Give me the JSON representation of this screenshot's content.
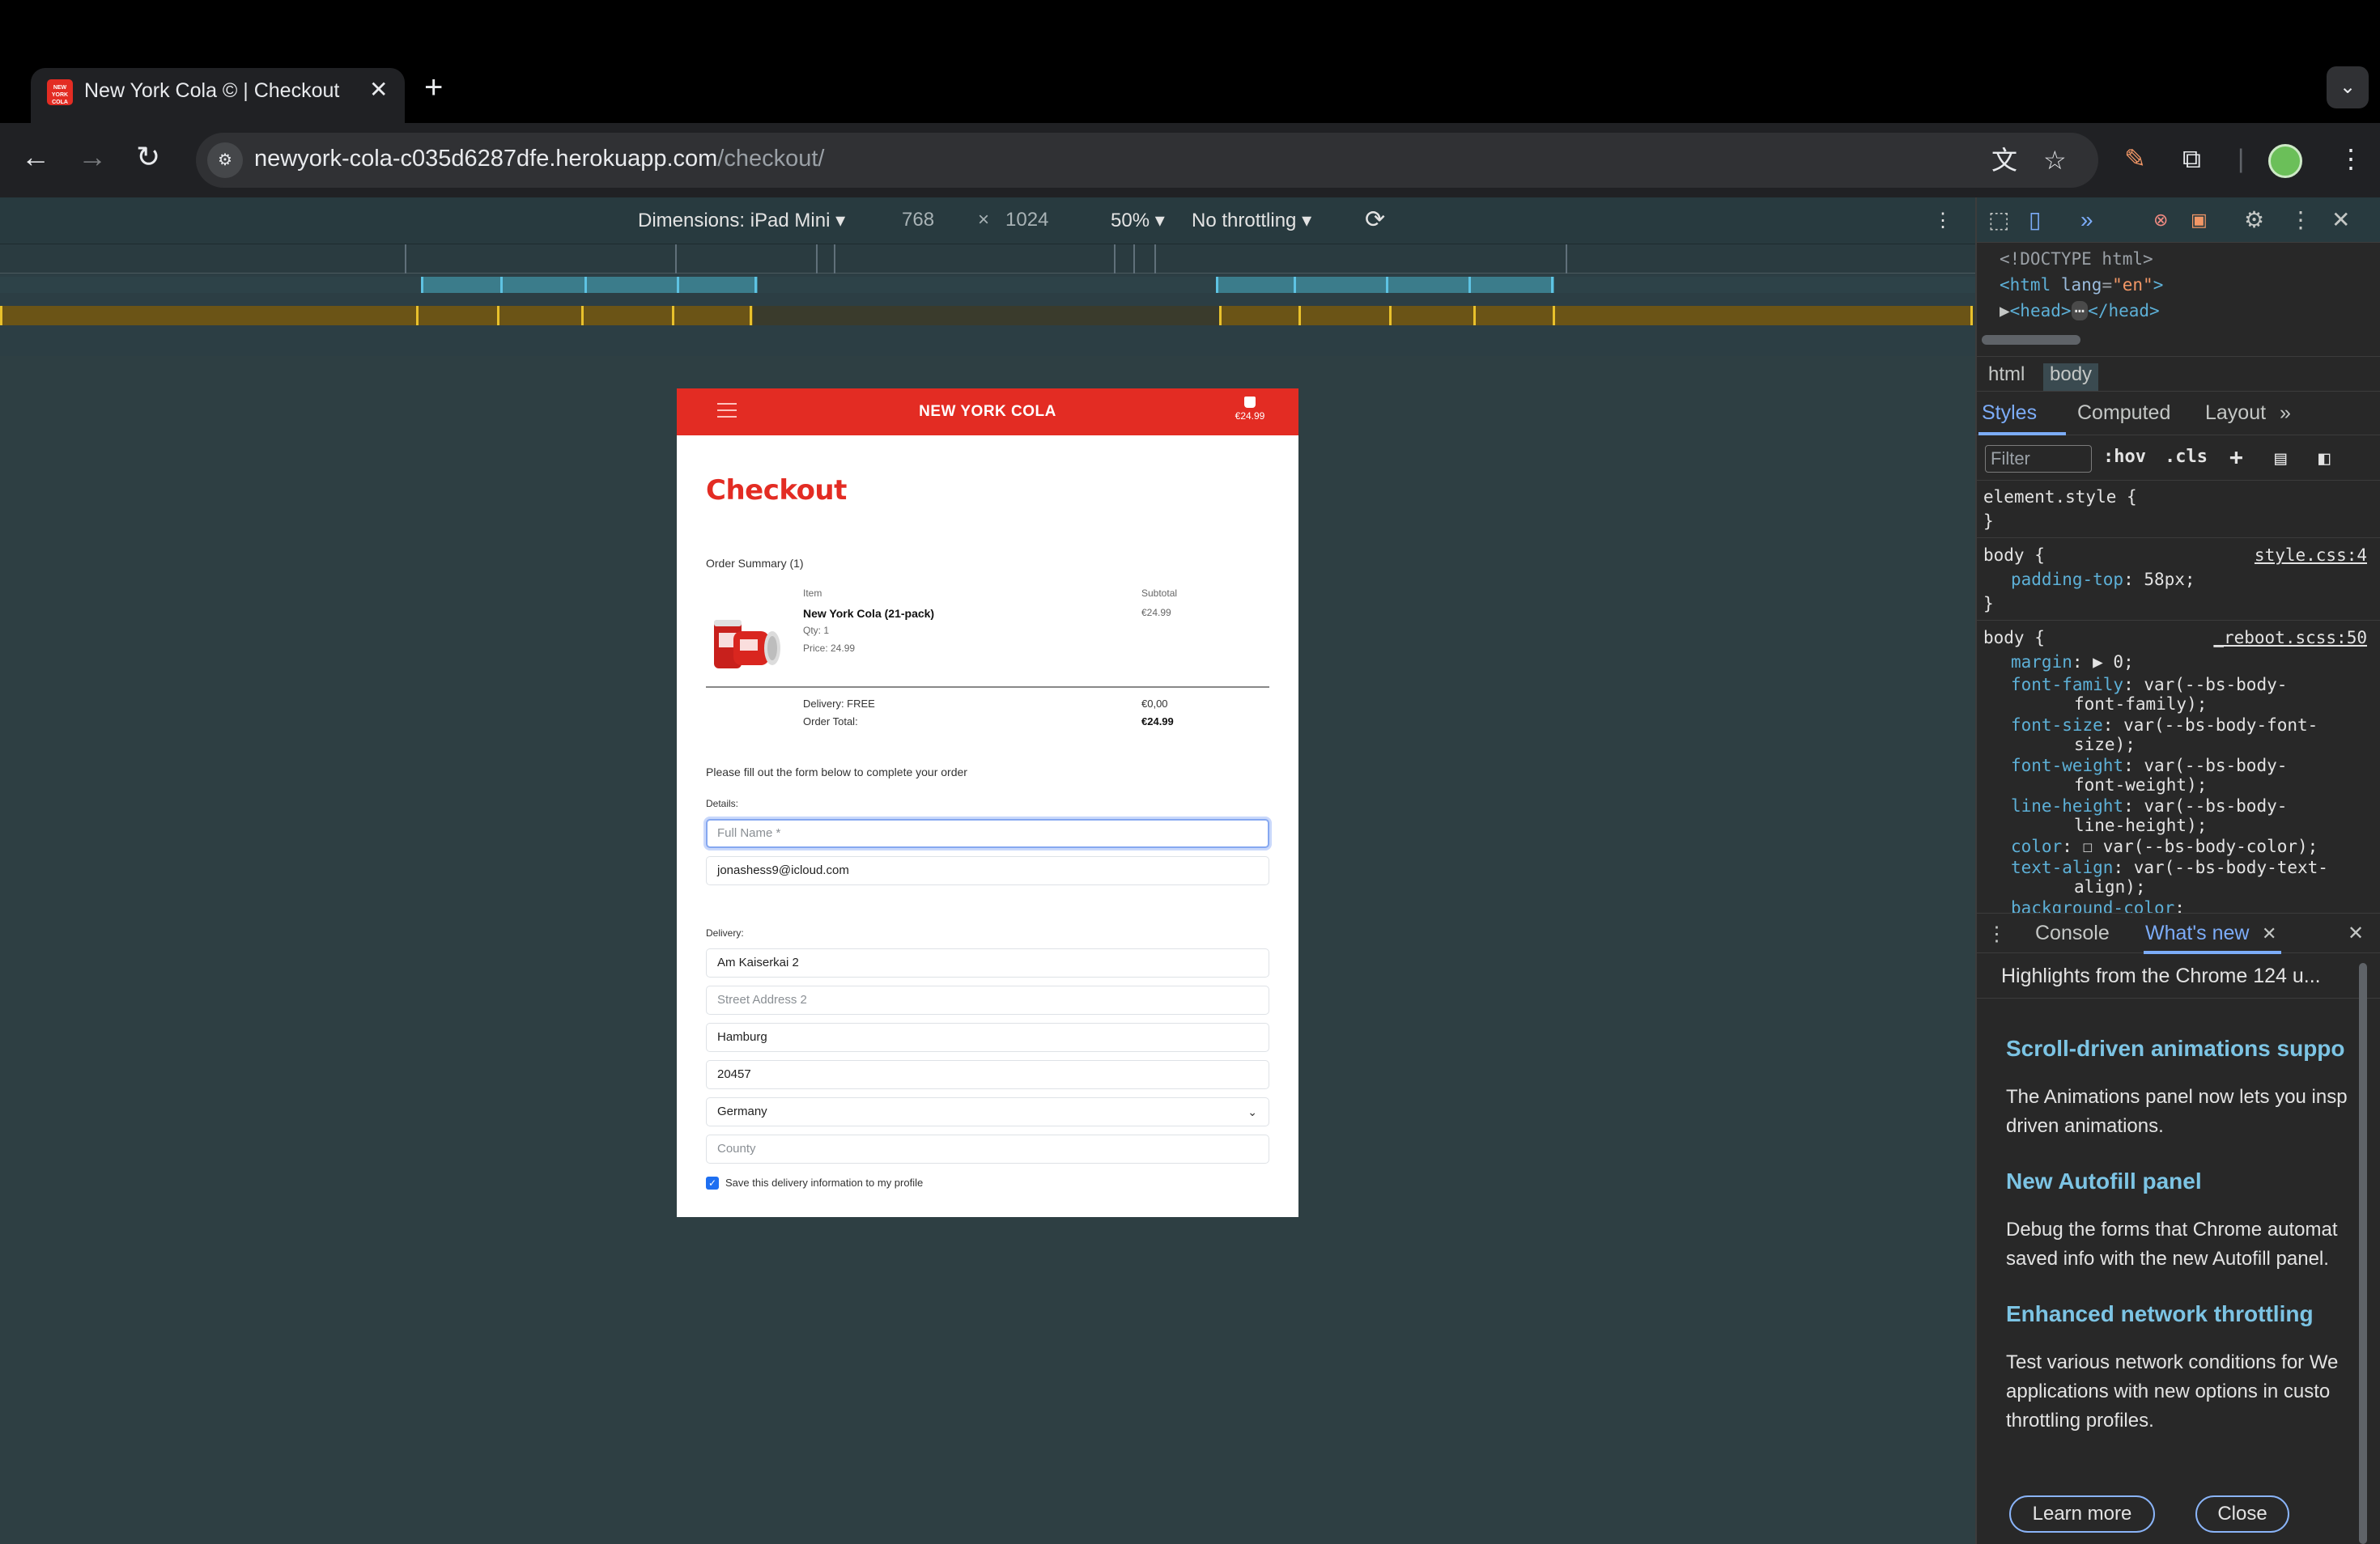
{
  "browser": {
    "tab_title": "New York Cola © | Checkout",
    "favicon_text": "NEW YORK COLA",
    "url_host": "newyork-cola-c035d6287dfe.herokuapp.com",
    "url_path": "/checkout/"
  },
  "device_toolbar": {
    "dimensions_label": "Dimensions: iPad Mini ▾",
    "width": "768",
    "times": "×",
    "height": "1024",
    "zoom": "50% ▾",
    "throttling": "No throttling ▾"
  },
  "page": {
    "brand": "NEW YORK COLA",
    "cart_amount": "€24.99",
    "heading": "Checkout",
    "summary": {
      "title": "Order Summary (1)",
      "col_item": "Item",
      "col_subtotal": "Subtotal",
      "product_name": "New York Cola (21-pack)",
      "qty": "Qty: 1",
      "price": "Price: 24.99",
      "line_subtotal": "€24.99",
      "delivery_label": "Delivery: FREE",
      "delivery_value": "€0,00",
      "total_label": "Order Total:",
      "total_value": "€24.99"
    },
    "form": {
      "intro": "Please fill out the form below to complete your order",
      "details_label": "Details:",
      "full_name_placeholder": "Full Name *",
      "email_value": "jonashess9@icloud.com",
      "delivery_label": "Delivery:",
      "street1_value": "Am Kaiserkai 2",
      "street2_placeholder": "Street Address 2",
      "city_value": "Hamburg",
      "postcode_value": "20457",
      "country_value": "Germany",
      "county_placeholder": "County",
      "save_info_label": "Save this delivery information to my profile",
      "save_info_checked": true
    }
  },
  "devtools": {
    "dom": {
      "doctype": "<!DOCTYPE html>",
      "html_open": "<html",
      "html_attr": "lang",
      "html_val": "\"en\"",
      "head": "<head>",
      "head_close": "</head>",
      "ellipsis": "⋯"
    },
    "breadcrumbs": [
      "html",
      "body"
    ],
    "subtabs": [
      "Styles",
      "Computed",
      "Layout"
    ],
    "filter_placeholder": "Filter",
    "hov": ":hov",
    "cls": ".cls",
    "styles": {
      "element_style": "element.style {",
      "close": "}",
      "body_sel": "body {",
      "src1": "style.css:4",
      "src2": "_reboot.scss:50",
      "padding_top_prop": "padding-top",
      "padding_top_val": ": 58px;",
      "margin_prop": "margin",
      "margin_val": ": ▶ 0;",
      "ff_prop": "font-family",
      "ff_val1": ": var(--bs-body-",
      "ff_val2": "font-family);",
      "fs_prop": "font-size",
      "fs_val1": ": var(--bs-body-font-",
      "fs_val2": "size);",
      "fw_prop": "font-weight",
      "fw_val1": ": var(--bs-body-",
      "fw_val2": "font-weight);",
      "lh_prop": "line-height",
      "lh_val1": ": var(--bs-body-",
      "lh_val2": "line-height);",
      "color_prop": "color",
      "color_val": ": ☐ var(--bs-body-color);",
      "ta_prop": "text-align",
      "ta_val1": ": var(--bs-body-text-",
      "ta_val2": "align);",
      "bg_prop": "background-color",
      "bg_val": ":"
    },
    "drawer_tabs": [
      "Console",
      "What's new"
    ],
    "whats_new": {
      "header": "Highlights from the Chrome 124 u...",
      "h1": "Scroll-driven animations suppo",
      "p1a": "The Animations panel now lets you insp",
      "p1b": "driven animations.",
      "h2": "New Autofill panel",
      "p2a": "Debug the forms that Chrome automat",
      "p2b": "saved info with the new Autofill panel.",
      "h3": "Enhanced network throttling",
      "p3a": "Test various network conditions for We",
      "p3b": "applications with new options in custo",
      "p3c": "throttling profiles.",
      "learn_more": "Learn more",
      "close": "Close"
    }
  }
}
